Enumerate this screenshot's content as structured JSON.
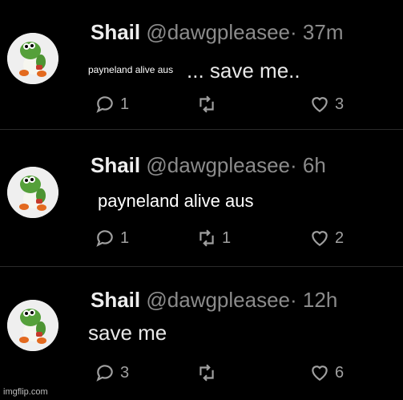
{
  "tweets": [
    {
      "name": "Shail",
      "handle": "@dawgpleasee",
      "time": "· 37m",
      "text": "... save me..",
      "overlay_caption": "payneland alive aus",
      "replies": "1",
      "retweets": "",
      "likes": "3"
    },
    {
      "name": "Shail",
      "handle": "@dawgpleasee",
      "time": "· 6h",
      "text": "",
      "overlay_caption": "payneland alive aus",
      "replies": "1",
      "retweets": "1",
      "likes": "2"
    },
    {
      "name": "Shail",
      "handle": "@dawgpleasee",
      "time": "· 12h",
      "text": "save me",
      "replies": "3",
      "retweets": "",
      "likes": "6"
    }
  ],
  "watermark": "imgflip.com",
  "icons": {
    "reply": "reply-icon",
    "retweet": "retweet-icon",
    "like": "heart-icon",
    "avatar": "yoshi-avatar"
  },
  "colors": {
    "background": "#000000",
    "text": "#e8e8e8",
    "muted": "#8b8b8b"
  }
}
